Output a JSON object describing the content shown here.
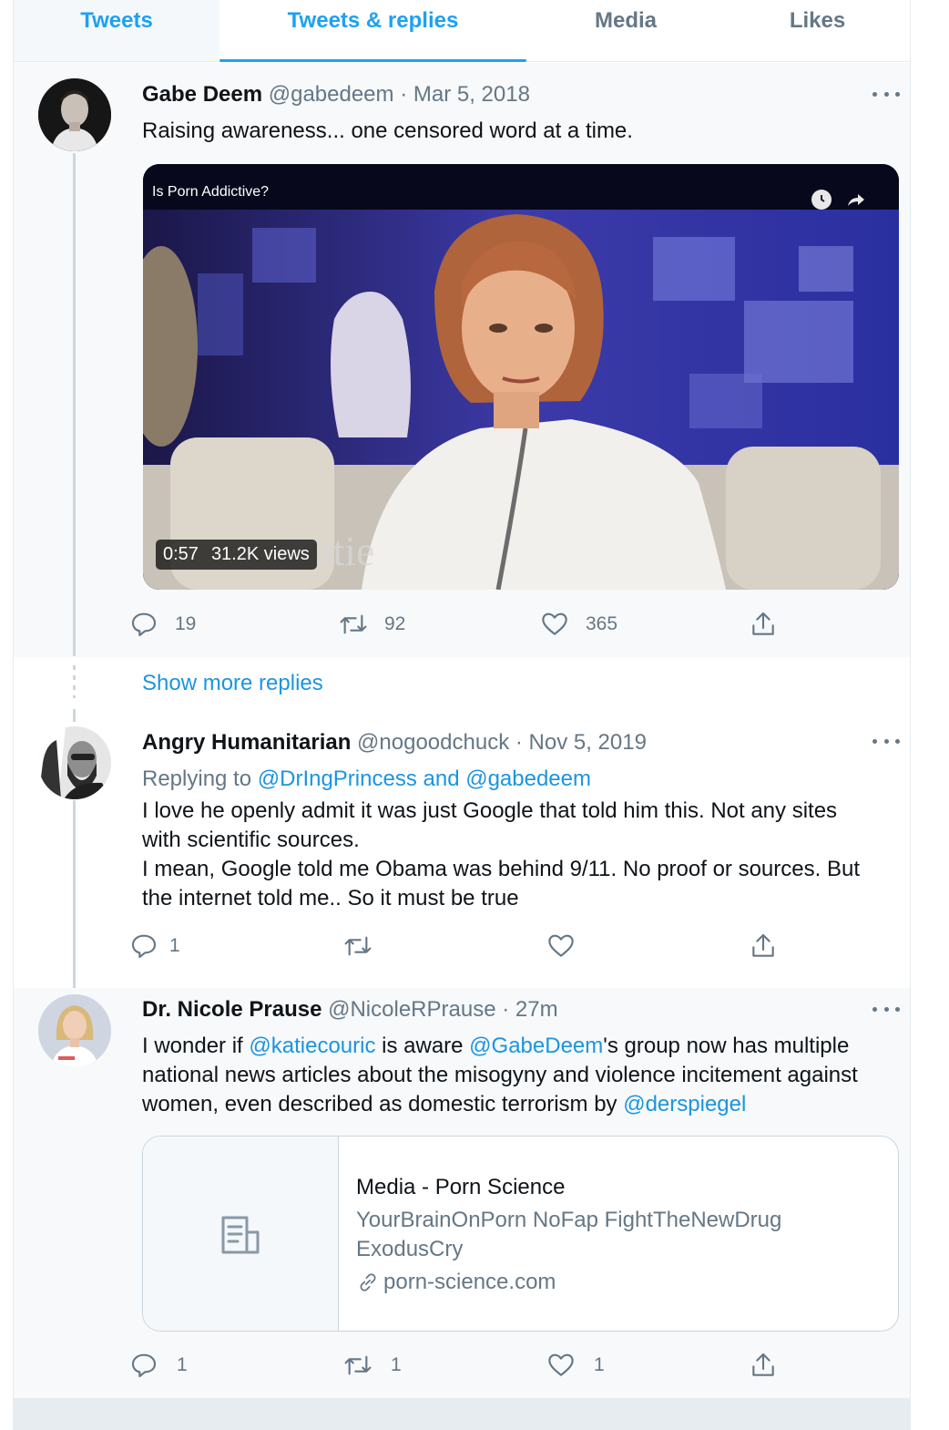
{
  "tabs": [
    {
      "label": "Tweets"
    },
    {
      "label": "Tweets & replies"
    },
    {
      "label": "Media"
    },
    {
      "label": "Likes"
    }
  ],
  "tweet1": {
    "name": "Gabe Deem",
    "meta": "@gabedeem · Mar 5, 2018",
    "text": "Raising awareness... one censored word at a time.",
    "video": {
      "title": "Is Porn Addictive?",
      "duration": "0:57",
      "views": "31.2K views",
      "watermark": "katie"
    },
    "actions": {
      "replies": "19",
      "retweets": "92",
      "likes": "365"
    }
  },
  "show_more": "Show more replies",
  "tweet2": {
    "name": "Angry Humanitarian",
    "meta": "@nogoodchuck · Nov 5, 2019",
    "replying_prefix": "Replying to ",
    "replying_to": "@DrIngPrincess and @gabedeem",
    "text_lines": [
      "I love he openly admit it was just Google that told him this. Not any sites",
      "with scientific sources.",
      "I mean, Google told me Obama was behind 9/11. No proof or sources. But",
      "the internet told me.. So it must be true"
    ],
    "actions": {
      "replies": "1",
      "retweets": "",
      "likes": ""
    }
  },
  "tweet3": {
    "name": "Dr. Nicole Prause",
    "meta": "@NicoleRPrause · 27m",
    "text": {
      "p1": "I wonder if ",
      "m1": "@katiecouric",
      "p2": " is aware ",
      "m2": "@GabeDeem",
      "p3": "'s group now has multiple national news articles about the misogyny and violence incitement against women, even described as domestic terrorism by ",
      "m3": "@derspiegel"
    },
    "card": {
      "title": "Media - Porn Science",
      "description": "YourBrainOnPorn NoFap FightTheNewDrug ExodusCry",
      "domain": "porn-science.com"
    },
    "actions": {
      "replies": "1",
      "retweets": "1",
      "likes": "1"
    }
  },
  "colors": {
    "accent": "#1da1f2",
    "link": "#1b95e0",
    "muted": "#657786",
    "border": "#e6ecf0"
  }
}
